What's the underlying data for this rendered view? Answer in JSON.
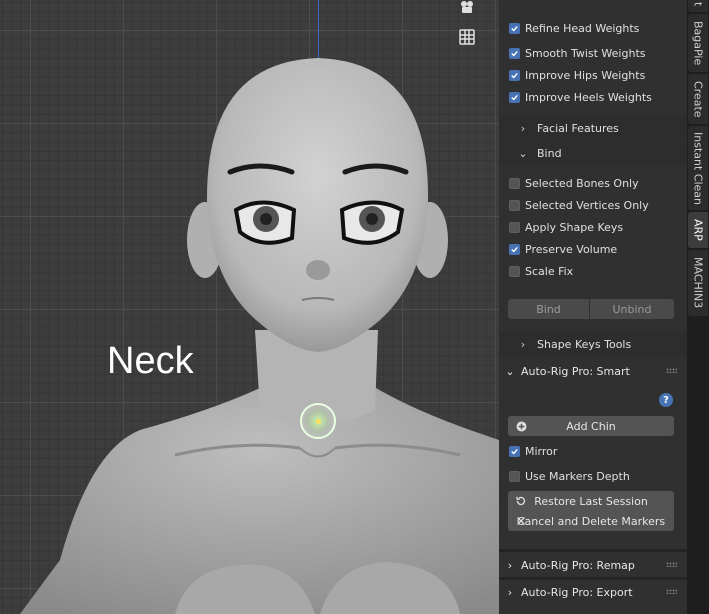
{
  "viewport": {
    "overlay_label": "Neck"
  },
  "panel": {
    "weight_options": [
      {
        "label": "Refine Head Weights",
        "checked": true
      },
      {
        "label": "Smooth Twist Weights",
        "checked": true
      },
      {
        "label": "Improve Hips Weights",
        "checked": true
      },
      {
        "label": "Improve Heels Weights",
        "checked": true
      }
    ],
    "facial_features": "Facial Features",
    "bind_header": "Bind",
    "bind_options": [
      {
        "label": "Selected Bones Only",
        "checked": false
      },
      {
        "label": "Selected Vertices Only",
        "checked": false
      },
      {
        "label": "Apply Shape Keys",
        "checked": false
      },
      {
        "label": "Preserve Volume",
        "checked": true
      },
      {
        "label": "Scale Fix",
        "checked": false
      }
    ],
    "bind_button": "Bind",
    "unbind_button": "Unbind",
    "shape_keys_tools": "Shape Keys Tools",
    "smart": {
      "title": "Auto-Rig Pro: Smart",
      "add_chin": "Add Chin",
      "mirror": {
        "label": "Mirror",
        "checked": true
      },
      "use_markers_depth": {
        "label": "Use Markers Depth",
        "checked": false
      },
      "restore_last_session": "Restore Last Session",
      "cancel_delete_markers": "Cancel and Delete Markers"
    },
    "remap_title": "Auto-Rig Pro: Remap",
    "export_title": "Auto-Rig Pro: Export"
  },
  "tabs": [
    {
      "label": "t",
      "active": false
    },
    {
      "label": "BagaPie",
      "active": false
    },
    {
      "label": "Create",
      "active": false
    },
    {
      "label": "Instant Clean",
      "active": false
    },
    {
      "label": "ARP",
      "active": true
    },
    {
      "label": "MACHIN3",
      "active": false
    }
  ],
  "colors": {
    "accent": "#4772b3",
    "panel_bg": "#303030",
    "viewport_bg": "#3d3d3d"
  }
}
